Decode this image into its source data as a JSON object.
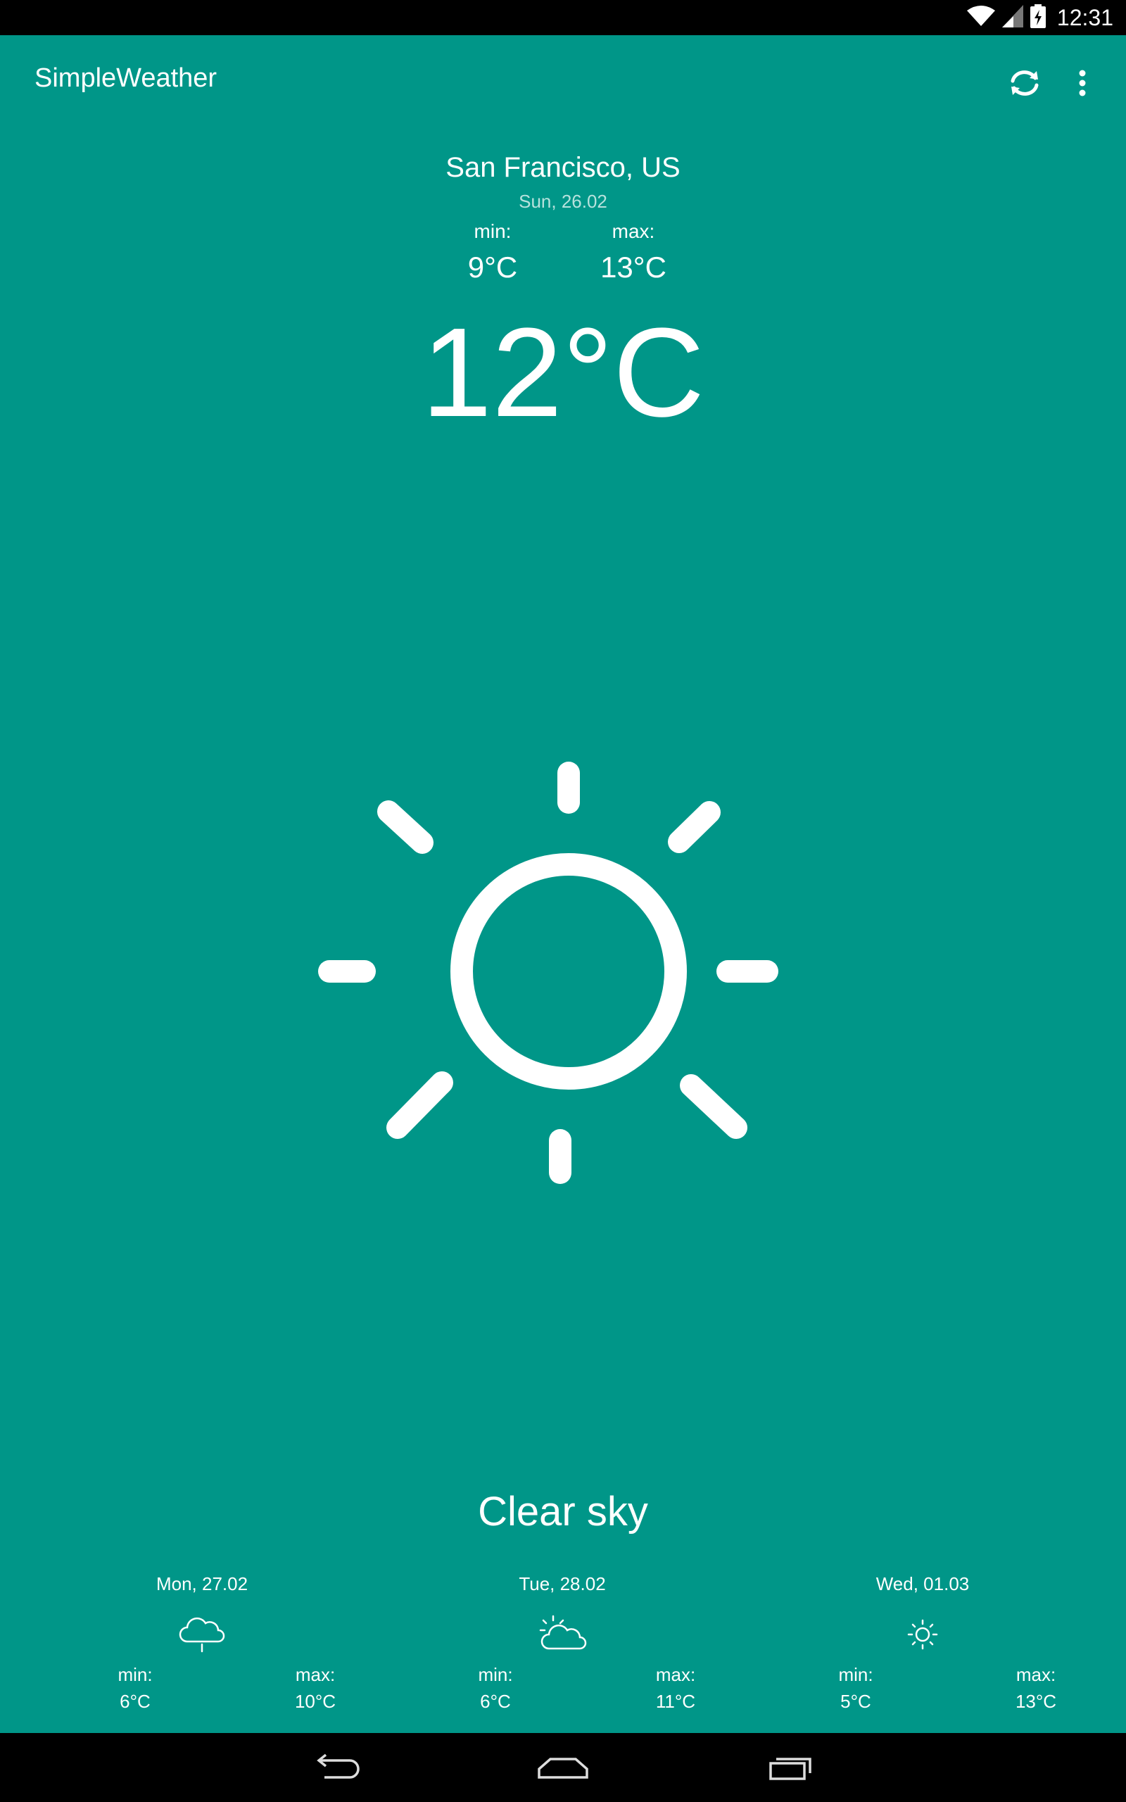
{
  "status_bar": {
    "time": "12:31"
  },
  "app_bar": {
    "title": "SimpleWeather",
    "refresh_icon": "refresh-icon",
    "overflow_icon": "more-vert-icon"
  },
  "current": {
    "location": "San Francisco, US",
    "date": "Sun, 26.02",
    "min_label": "min:",
    "min_value": "9°C",
    "max_label": "max:",
    "max_value": "13°C",
    "temperature": "12°C",
    "condition_icon": "sun-icon",
    "condition": "Clear sky"
  },
  "forecast": [
    {
      "date": "Mon, 27.02",
      "icon": "rain-cloud-icon",
      "min_label": "min:",
      "min_value": "6°C",
      "max_label": "max:",
      "max_value": "10°C"
    },
    {
      "date": "Tue, 28.02",
      "icon": "partly-cloudy-icon",
      "min_label": "min:",
      "min_value": "6°C",
      "max_label": "max:",
      "max_value": "11°C"
    },
    {
      "date": "Wed, 01.03",
      "icon": "sun-icon",
      "min_label": "min:",
      "min_value": "5°C",
      "max_label": "max:",
      "max_value": "13°C"
    }
  ],
  "colors": {
    "background": "#009688",
    "bars": "#000000",
    "foreground": "#ffffff",
    "secondary_text": "#b7e2dd"
  }
}
